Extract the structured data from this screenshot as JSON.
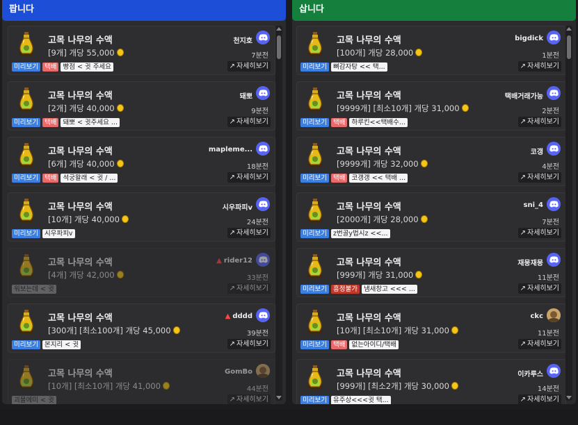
{
  "colors": {
    "sell_header": "#1d4ed8",
    "buy_header": "#15803d"
  },
  "sell": {
    "header": "팝니다",
    "cards": [
      {
        "title": "고목 나무의 수액",
        "price": "[9개] 개당 55,000",
        "seller": "천지호",
        "time": "7분전",
        "tags": [
          {
            "type": "preview",
            "label": "미리보기"
          },
          {
            "type": "delivery",
            "label": "택배"
          },
          {
            "type": "memo",
            "label": "빵점 < 귓 주세요"
          }
        ],
        "detail": "자세히보기",
        "faded": false,
        "warn": false,
        "icon": "discord-icon"
      },
      {
        "title": "고목 나무의 수액",
        "price": "[2개] 개당 40,000",
        "seller": "돼뽀",
        "time": "9분전",
        "tags": [
          {
            "type": "preview",
            "label": "미리보기"
          },
          {
            "type": "delivery",
            "label": "택배"
          },
          {
            "type": "memo",
            "label": "돼뽀 < 귓주세요 ..."
          }
        ],
        "detail": "자세히보기",
        "faded": false,
        "warn": false,
        "icon": "discord-icon"
      },
      {
        "title": "고목 나무의 수액",
        "price": "[6개] 개당 40,000",
        "seller": "mapleme...",
        "time": "18분전",
        "tags": [
          {
            "type": "preview",
            "label": "미리보기"
          },
          {
            "type": "delivery",
            "label": "택배"
          },
          {
            "type": "memo",
            "label": "석궁왈래 < 귓 / ..."
          }
        ],
        "detail": "자세히보기",
        "faded": false,
        "warn": false,
        "icon": "discord-icon"
      },
      {
        "title": "고목 나무의 수액",
        "price": "[10개] 개당 40,000",
        "seller": "시우파피v",
        "time": "24분전",
        "tags": [
          {
            "type": "preview",
            "label": "미리보기"
          },
          {
            "type": "memo",
            "label": "시우파피v"
          }
        ],
        "detail": "자세히보기",
        "faded": false,
        "warn": false,
        "icon": "discord-icon"
      },
      {
        "title": "고목 나무의 수액",
        "price": "[4개] 개당 42,000",
        "seller": "rider12",
        "time": "33분전",
        "tags": [
          {
            "type": "memo-gray",
            "label": "워보는데 < 귓"
          }
        ],
        "detail": "자세히보기",
        "faded": true,
        "warn": true,
        "icon": "discord-icon"
      },
      {
        "title": "고목 나무의 수액",
        "price": "[300개] [최소100개] 개당 45,000",
        "seller": "dddd",
        "time": "39분전",
        "tags": [
          {
            "type": "preview",
            "label": "미리보기"
          },
          {
            "type": "memo",
            "label": "본지리 < 귓"
          }
        ],
        "detail": "자세히보기",
        "faded": false,
        "warn": true,
        "icon": "discord-icon"
      },
      {
        "title": "고목 나무의 수액",
        "price": "[10개] [최소10개] 개당 41,000",
        "seller": "GomBo",
        "time": "44분전",
        "tags": [
          {
            "type": "memo-gray",
            "label": "괴물에미 < 귓"
          }
        ],
        "detail": "자세히보기",
        "faded": true,
        "warn": false,
        "icon": "avatar"
      }
    ]
  },
  "buy": {
    "header": "삽니다",
    "cards": [
      {
        "title": "고목 나무의 수액",
        "price": "[100개] 개당 28,000",
        "seller": "bigdick",
        "time": "1분전",
        "tags": [
          {
            "type": "preview",
            "label": "미리보기"
          },
          {
            "type": "memo",
            "label": "뼈감자탕 << 택..."
          }
        ],
        "detail": "자세히보기",
        "faded": false,
        "warn": false,
        "icon": "discord-icon"
      },
      {
        "title": "고목 나무의 수액",
        "price": "[9999개] [최소10개] 개당 31,000",
        "seller": "택배거래가능",
        "time": "2분전",
        "tags": [
          {
            "type": "preview",
            "label": "미리보기"
          },
          {
            "type": "delivery",
            "label": "택배"
          },
          {
            "type": "memo",
            "label": "하루킨<<택배수..."
          }
        ],
        "detail": "자세히보기",
        "faded": false,
        "warn": false,
        "icon": "discord-icon"
      },
      {
        "title": "고목 나무의 수액",
        "price": "[9999개] 개당 32,000",
        "seller": "코갱",
        "time": "4분전",
        "tags": [
          {
            "type": "preview",
            "label": "미리보기"
          },
          {
            "type": "delivery",
            "label": "택배"
          },
          {
            "type": "memo",
            "label": "코갱갱 << 택배 ..."
          }
        ],
        "detail": "자세히보기",
        "faded": false,
        "warn": false,
        "icon": "discord-icon"
      },
      {
        "title": "고목 나무의 수액",
        "price": "[2000개] 개당 28,000",
        "seller": "sni_4",
        "time": "7분전",
        "tags": [
          {
            "type": "preview",
            "label": "미리보기"
          },
          {
            "type": "memo",
            "label": "z번골y법시z <<..."
          }
        ],
        "detail": "자세히보기",
        "faded": false,
        "warn": false,
        "icon": "discord-icon"
      },
      {
        "title": "고목 나무의 수액",
        "price": "[999개] 개당 31,000",
        "seller": "재몽재몽",
        "time": "11분전",
        "tags": [
          {
            "type": "preview",
            "label": "미리보기"
          },
          {
            "type": "nonego",
            "label": "흥정불가"
          },
          {
            "type": "memo",
            "label": "냄새창고 <<< ..."
          }
        ],
        "detail": "자세히보기",
        "faded": false,
        "warn": false,
        "icon": "discord-icon"
      },
      {
        "title": "고목 나무의 수액",
        "price": "[10개] [최소10개] 개당 31,000",
        "seller": "ckc",
        "time": "11분전",
        "tags": [
          {
            "type": "preview",
            "label": "미리보기"
          },
          {
            "type": "delivery",
            "label": "택배"
          },
          {
            "type": "memo",
            "label": "없는아이디/택배"
          }
        ],
        "detail": "자세히보기",
        "faded": false,
        "warn": false,
        "icon": "avatar"
      },
      {
        "title": "고목 나무의 수액",
        "price": "[999개] [최소2개] 개당 30,000",
        "seller": "이카루스",
        "time": "14분전",
        "tags": [
          {
            "type": "preview",
            "label": "미리보기"
          },
          {
            "type": "memo",
            "label": "유주상<<<귓 택..."
          }
        ],
        "detail": "자세히보기",
        "faded": false,
        "warn": false,
        "icon": "discord-icon"
      }
    ]
  }
}
